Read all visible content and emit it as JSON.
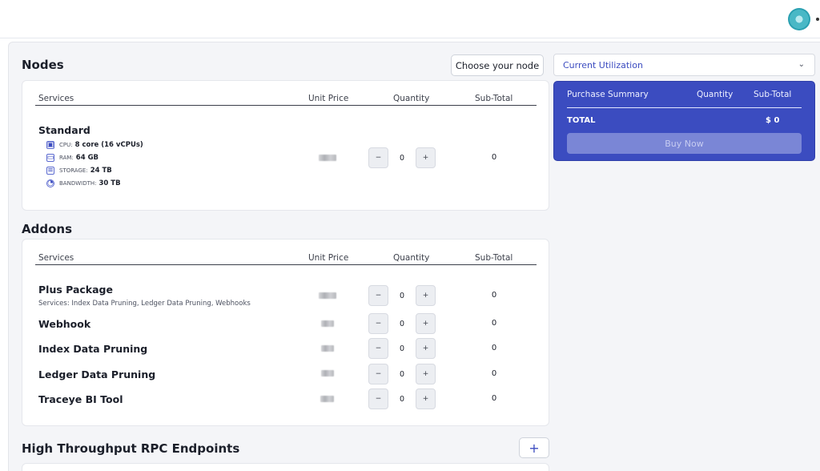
{
  "nodes": {
    "title": "Nodes",
    "choose_label": "Choose your node",
    "headers": {
      "services": "Services",
      "unit_price": "Unit Price",
      "quantity": "Quantity",
      "subtotal": "Sub-Total"
    },
    "plan": {
      "name": "Standard",
      "specs": [
        {
          "icon": "cpu-icon",
          "label": "CPU:",
          "value": "8 core (16 vCPUs)"
        },
        {
          "icon": "ram-icon",
          "label": "RAM:",
          "value": "64 GB"
        },
        {
          "icon": "storage-icon",
          "label": "STORAGE:",
          "value": "24 TB"
        },
        {
          "icon": "bandwidth-icon",
          "label": "BANDWIDTH:",
          "value": "30 TB"
        }
      ],
      "quantity": "0",
      "subtotal": "0"
    }
  },
  "addons": {
    "title": "Addons",
    "headers": {
      "services": "Services",
      "unit_price": "Unit Price",
      "quantity": "Quantity",
      "subtotal": "Sub-Total"
    },
    "items": [
      {
        "name": "Plus Package",
        "services": "Services: Index Data Pruning, Ledger Data Pruning, Webhooks",
        "quantity": "0",
        "subtotal": "0"
      },
      {
        "name": "Webhook",
        "quantity": "0",
        "subtotal": "0"
      },
      {
        "name": "Index Data Pruning",
        "quantity": "0",
        "subtotal": "0"
      },
      {
        "name": "Ledger Data Pruning",
        "quantity": "0",
        "subtotal": "0"
      },
      {
        "name": "Traceye BI Tool",
        "quantity": "0",
        "subtotal": "0"
      }
    ]
  },
  "rpc": {
    "title": "High Throughput RPC Endpoints",
    "add_label": "+"
  },
  "stepper": {
    "minus": "−",
    "plus": "+"
  },
  "utilization": {
    "label": "Current Utilization",
    "chevron": "⌄"
  },
  "summary": {
    "headers": {
      "title": "Purchase Summary",
      "quantity": "Quantity",
      "subtotal": "Sub-Total"
    },
    "total_label": "TOTAL",
    "total_value": "$ 0",
    "buy_label": "Buy Now"
  },
  "colors": {
    "accent": "#3b4cc0",
    "button_disabled": "#7a86d6"
  }
}
